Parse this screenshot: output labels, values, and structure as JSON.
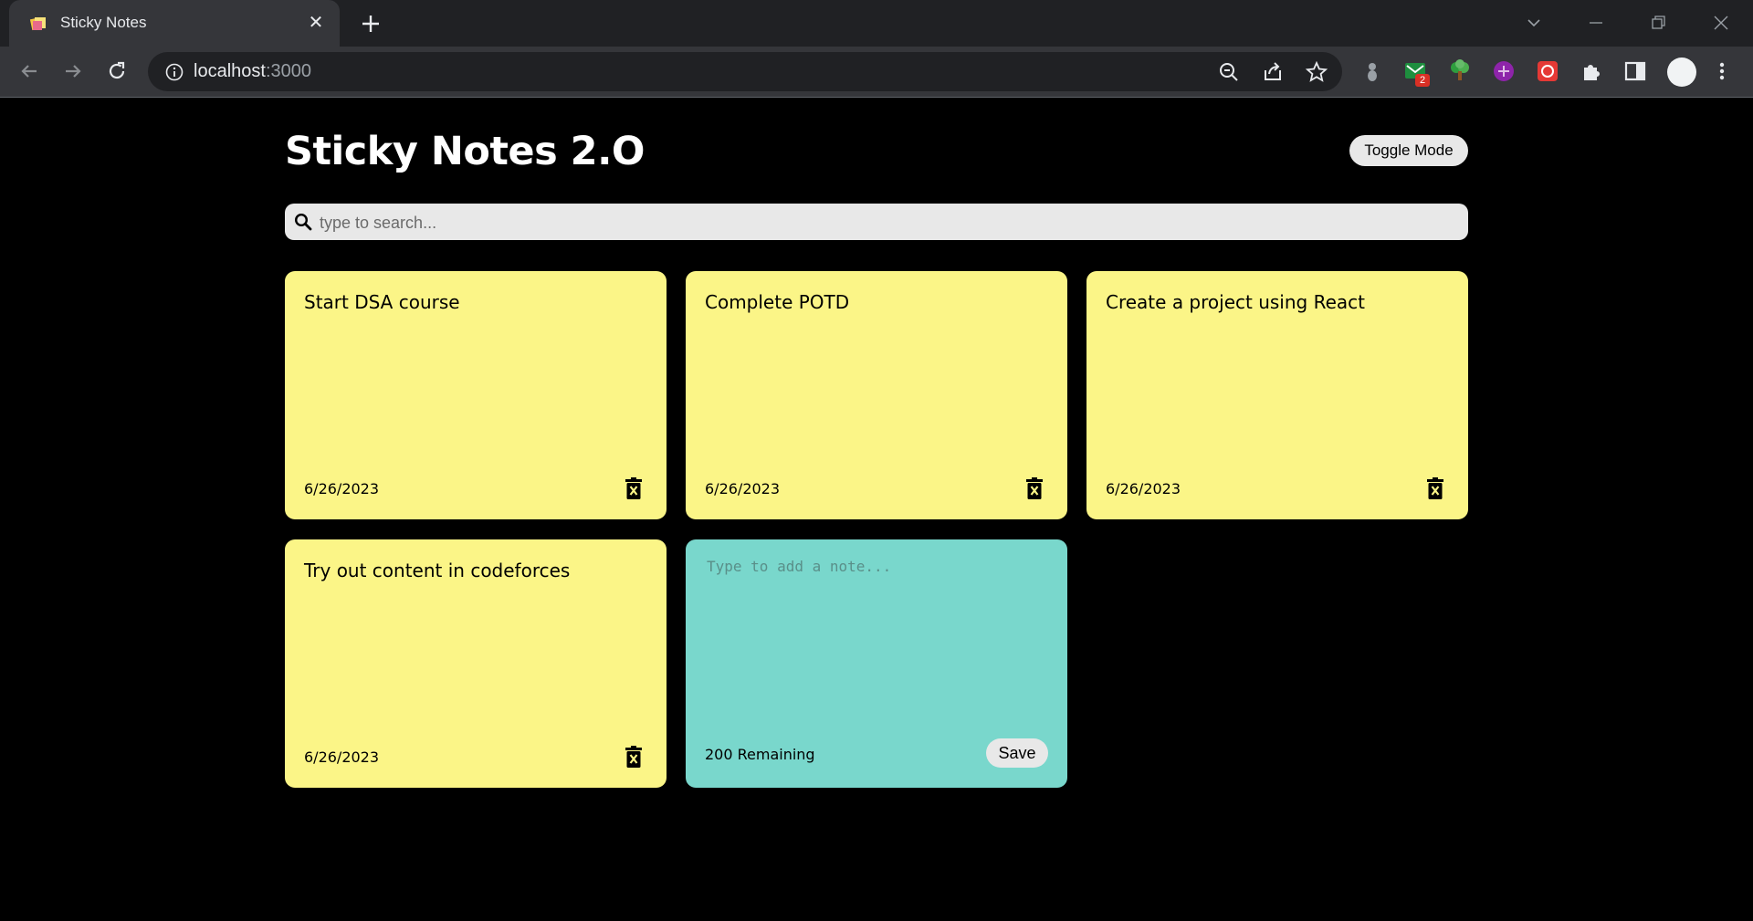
{
  "browser": {
    "tab_title": "Sticky Notes",
    "tab_close_glyph": "✕",
    "url_host": "localhost",
    "url_port": ":3000",
    "extension_badge": "2"
  },
  "app": {
    "title": "Sticky Notes 2.O",
    "toggle_label": "Toggle Mode",
    "search_placeholder": "type to search...",
    "notes": [
      {
        "text": "Start DSA course",
        "date": "6/26/2023"
      },
      {
        "text": "Complete POTD",
        "date": "6/26/2023"
      },
      {
        "text": "Create a project using React",
        "date": "6/26/2023"
      },
      {
        "text": "Try out content in codeforces",
        "date": "6/26/2023"
      }
    ],
    "new_note": {
      "placeholder": "Type to add a note...",
      "remaining": "200 Remaining",
      "save_label": "Save"
    }
  },
  "colors": {
    "note_yellow": "#fbf587",
    "new_note_teal": "#79d7cc",
    "page_background": "#000000"
  }
}
